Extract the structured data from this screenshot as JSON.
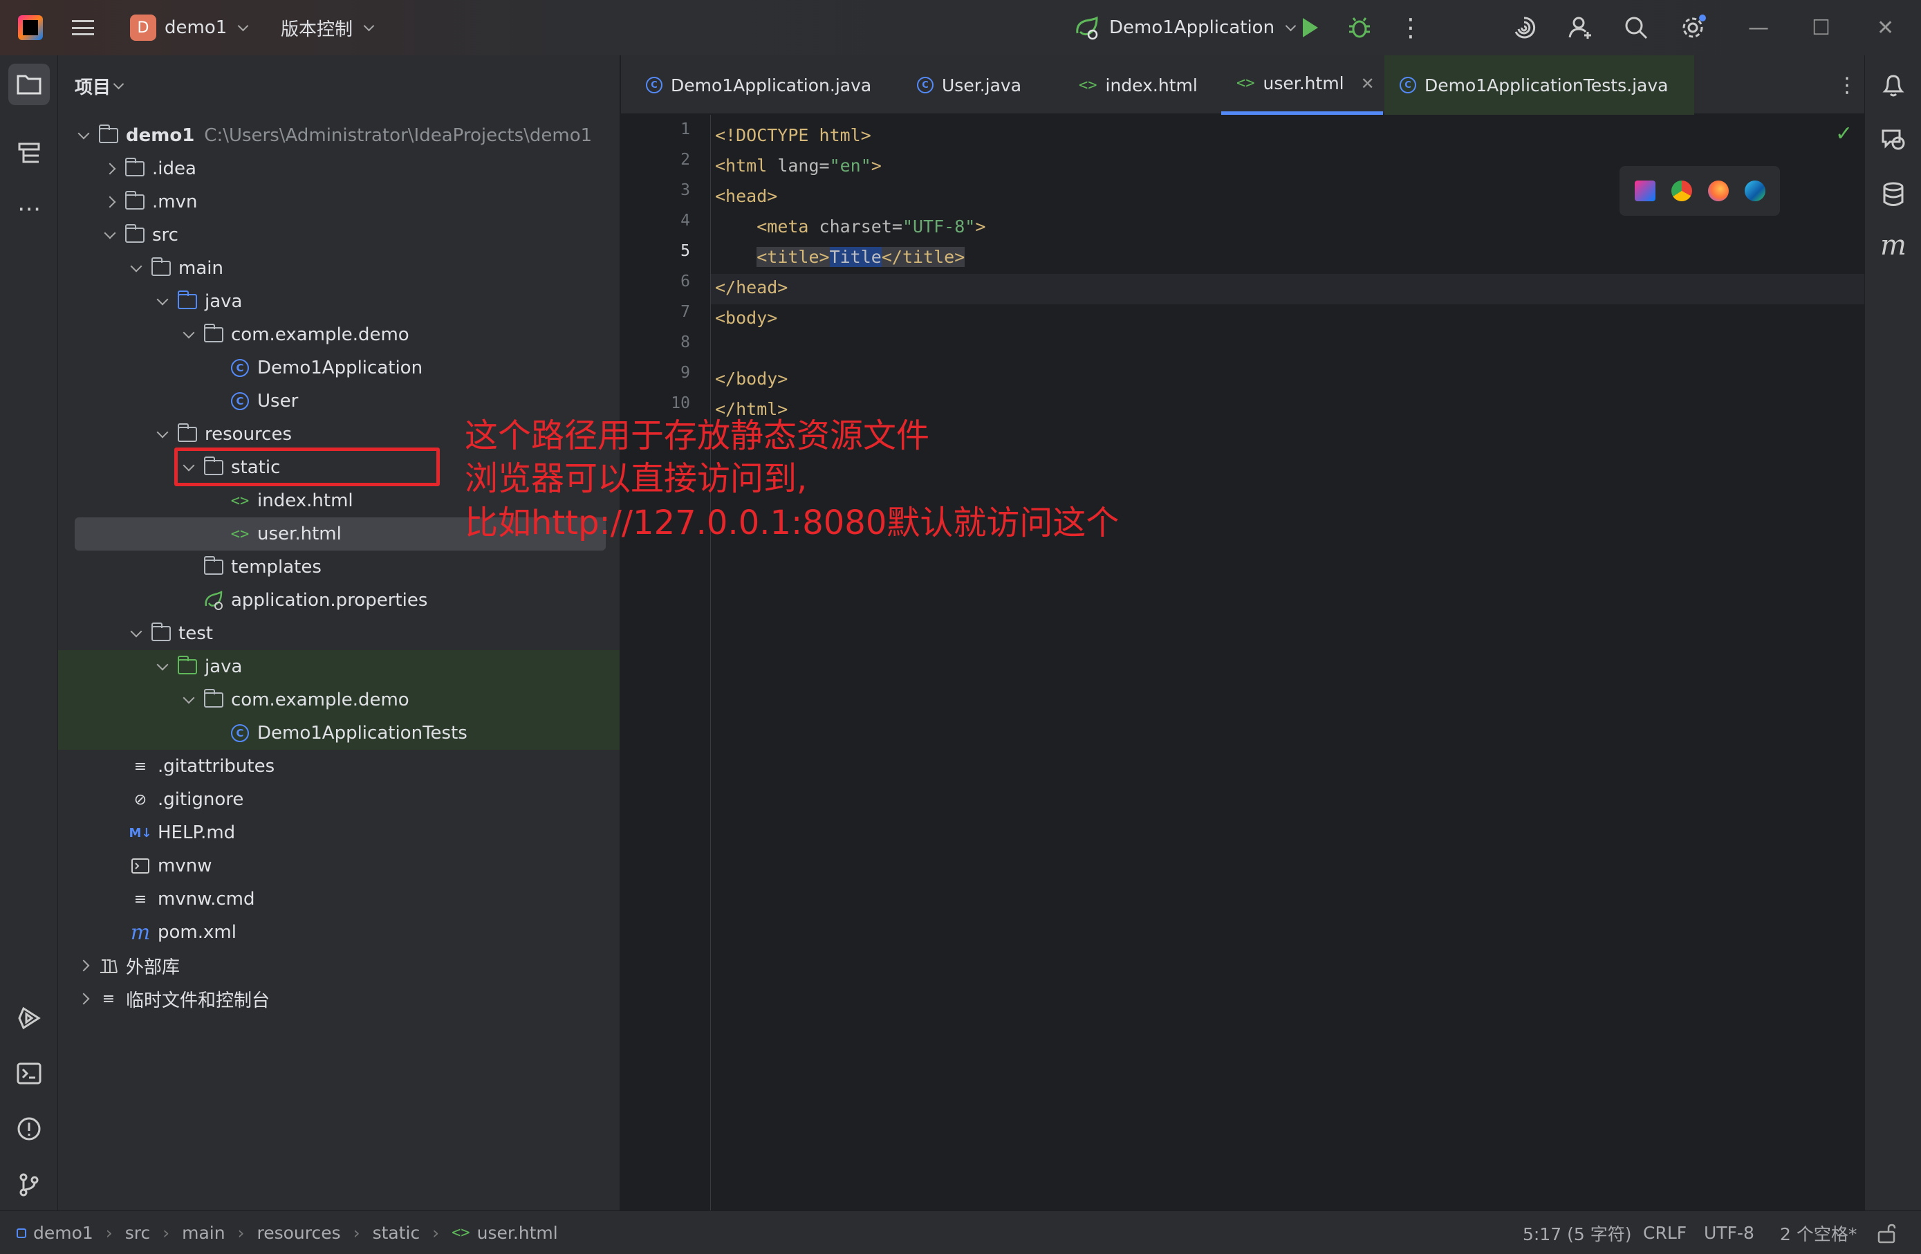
{
  "titlebar": {
    "project_badge": "D",
    "project_name": "demo1",
    "vcs_label": "版本控制",
    "run_config": "Demo1Application"
  },
  "project_panel": {
    "header": "项目",
    "tree": [
      {
        "label": "demo1",
        "path": "C:\\Users\\Administrator\\IdeaProjects\\demo1"
      },
      {
        "label": ".idea"
      },
      {
        "label": ".mvn"
      },
      {
        "label": "src"
      },
      {
        "label": "main"
      },
      {
        "label": "java"
      },
      {
        "label": "com.example.demo"
      },
      {
        "label": "Demo1Application"
      },
      {
        "label": "User"
      },
      {
        "label": "resources"
      },
      {
        "label": "static"
      },
      {
        "label": "index.html"
      },
      {
        "label": "user.html"
      },
      {
        "label": "templates"
      },
      {
        "label": "application.properties"
      },
      {
        "label": "test"
      },
      {
        "label": "java"
      },
      {
        "label": "com.example.demo"
      },
      {
        "label": "Demo1ApplicationTests"
      },
      {
        "label": ".gitattributes"
      },
      {
        "label": ".gitignore"
      },
      {
        "label": "HELP.md"
      },
      {
        "label": "mvnw"
      },
      {
        "label": "mvnw.cmd"
      },
      {
        "label": "pom.xml"
      },
      {
        "label": "外部库"
      },
      {
        "label": "临时文件和控制台"
      }
    ]
  },
  "tabs": [
    {
      "label": "Demo1Application.java"
    },
    {
      "label": "User.java"
    },
    {
      "label": "index.html"
    },
    {
      "label": "user.html",
      "active": true
    },
    {
      "label": "Demo1ApplicationTests.java"
    }
  ],
  "editor": {
    "line_numbers": [
      "1",
      "2",
      "3",
      "4",
      "5",
      "6",
      "7",
      "8",
      "9",
      "10"
    ],
    "lines": {
      "l1": "<!DOCTYPE html>",
      "l2_open": "<html ",
      "l2_attr": "lang=",
      "l2_str": "\"en\"",
      "l2_close": ">",
      "l3": "<head>",
      "l4_indent": "    ",
      "l4_open": "<meta ",
      "l4_attr": "charset=",
      "l4_str": "\"UTF-8\"",
      "l4_close": ">",
      "l5_indent": "    ",
      "l5_open": "<title>",
      "l5_text": "Title",
      "l5_close": "</title>",
      "l6": "</head>",
      "l7": "<body>",
      "l9": "</body>",
      "l10": "</html>"
    }
  },
  "annotation": {
    "line1": "这个路径用于存放静态资源文件",
    "line2": "浏览器可以直接访问到,",
    "line3": "比如http://127.0.0.1:8080默认就访问这个"
  },
  "statusbar": {
    "breadcrumbs": [
      "demo1",
      "src",
      "main",
      "resources",
      "static",
      "user.html"
    ],
    "position": "5:17 (5 字符)",
    "line_ending": "CRLF",
    "encoding": "UTF-8",
    "indent": "2 个空格*"
  }
}
